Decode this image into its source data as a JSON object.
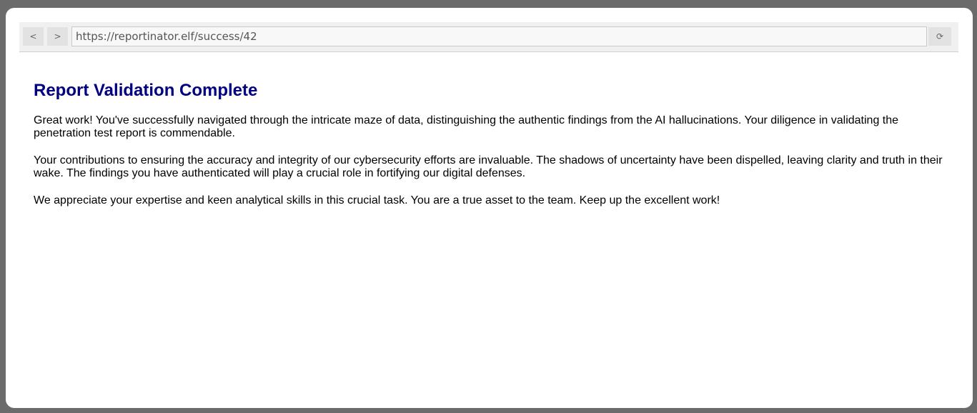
{
  "browser": {
    "back_label": "<",
    "forward_label": ">",
    "url": "https://reportinator.elf/success/42",
    "reload_label": "⟳"
  },
  "page": {
    "title": "Report Validation Complete",
    "paragraphs": [
      "Great work! You've successfully navigated through the intricate maze of data, distinguishing the authentic findings from the AI hallucinations. Your diligence in validating the penetration test report is commendable.",
      "Your contributions to ensuring the accuracy and integrity of our cybersecurity efforts are invaluable. The shadows of uncertainty have been dispelled, leaving clarity and truth in their wake. The findings you have authenticated will play a crucial role in fortifying our digital defenses.",
      "We appreciate your expertise and keen analytical skills in this crucial task. You are a true asset to the team. Keep up the excellent work!"
    ]
  }
}
